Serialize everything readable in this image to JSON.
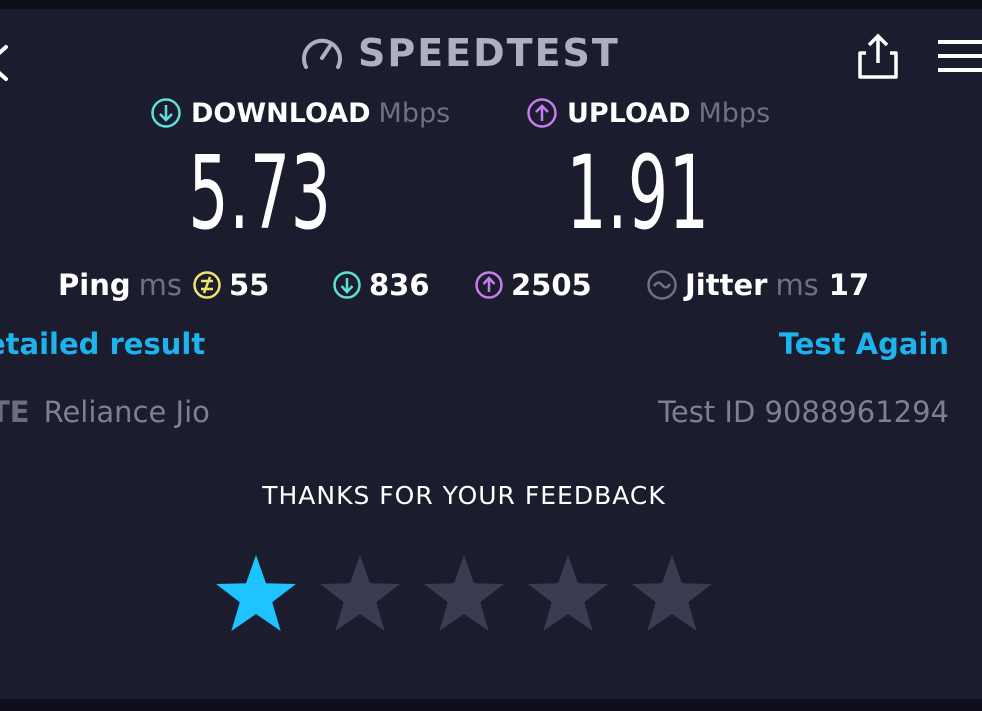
{
  "header": {
    "brand": "SPEEDTEST"
  },
  "download": {
    "label": "DOWNLOAD",
    "unit": "Mbps",
    "value": "5.73"
  },
  "upload": {
    "label": "UPLOAD",
    "unit": "Mbps",
    "value": "1.91"
  },
  "stats": {
    "ping_label": "Ping",
    "ping_unit": "ms",
    "ping_value": "55",
    "download_latency": "836",
    "upload_latency": "2505",
    "jitter_label": "Jitter",
    "jitter_unit": "ms",
    "jitter_value": "17"
  },
  "links": {
    "detailed": "etailed result",
    "test_again": "Test Again"
  },
  "info": {
    "provider_badge": "TE",
    "provider": "Reliance Jio",
    "test_id": "Test ID 9088961294"
  },
  "feedback": {
    "title": "THANKS FOR YOUR FEEDBACK",
    "rating": 1,
    "max": 5
  },
  "colors": {
    "background": "#1b1c2e",
    "download_accent": "#5ee0d9",
    "upload_accent": "#c77bf0",
    "ping_accent": "#f2e26a",
    "link": "#1fb3ee",
    "star_active": "#1ec3ff",
    "star_inactive": "#3a3c52"
  },
  "icons": [
    "back-icon",
    "speedometer-icon",
    "share-icon",
    "menu-icon",
    "download-arrow-icon",
    "upload-arrow-icon",
    "ping-icon",
    "jitter-icon",
    "star-icon"
  ]
}
